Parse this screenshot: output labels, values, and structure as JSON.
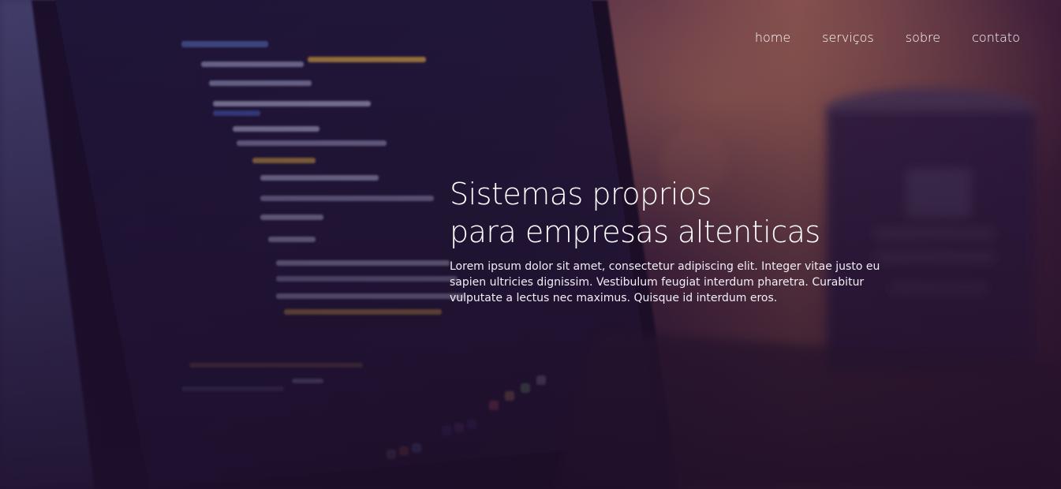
{
  "nav": {
    "items": [
      {
        "label": "home"
      },
      {
        "label": "serviços"
      },
      {
        "label": "sobre"
      },
      {
        "label": "contato"
      }
    ]
  },
  "hero": {
    "title_line1": "Sistemas proprios",
    "title_line2": "para empresas altenticas",
    "text": "Lorem ipsum dolor sit amet, consectetur adipiscing elit. Integer vitae justo eu sapien ultricies dignissim. Vestibulum feugiat interdum pharetra. Curabitur vulputate a lectus nec maximus. Quisque id interdum eros."
  },
  "colors": {
    "overlay": "#2a1536",
    "text": "#ffffff"
  }
}
